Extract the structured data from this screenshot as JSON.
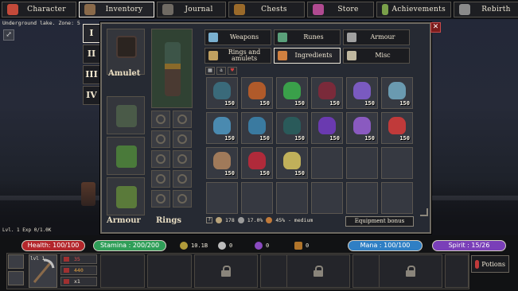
{
  "nav": [
    {
      "label": "Character",
      "icon": "skull-character-icon",
      "color": "#c44a3a"
    },
    {
      "label": "Inventory",
      "icon": "backpack-icon",
      "color": "#8a6a4a",
      "active": true
    },
    {
      "label": "Journal",
      "icon": "quill-icon",
      "color": "#6f6a63"
    },
    {
      "label": "Chests",
      "icon": "chest-icon",
      "color": "#9a6a2a"
    },
    {
      "label": "Store",
      "icon": "gem-store-icon",
      "color": "#b04a90"
    },
    {
      "label": "Achievements",
      "icon": "trophy-achievements-icon",
      "color": "#7aa04a"
    },
    {
      "label": "Rebirth",
      "icon": "rebirth-swirl-icon",
      "color": "#8a8a8a"
    }
  ],
  "zone_text": "Underground lake. Zone: 5",
  "level_exp": "Lvl. 1 Exp 0/1.0K",
  "tiers": [
    "I",
    "II",
    "III",
    "IV"
  ],
  "equipment": {
    "amulet_label": "Amulet",
    "armour_label": "Armour",
    "rings_label": "Rings"
  },
  "categories": [
    {
      "label": "Weapons",
      "icon": "sword-icon",
      "color": "#7ab0d0"
    },
    {
      "label": "Runes",
      "icon": "rune-icon",
      "color": "#5aa07a"
    },
    {
      "label": "Armour",
      "icon": "helmet-icon",
      "color": "#a0a0a0"
    },
    {
      "label": "Rings and amulets",
      "icon": "ring-icon",
      "color": "#c0a060"
    },
    {
      "label": "Ingredients",
      "icon": "herb-icon",
      "color": "#d08040",
      "active": true
    },
    {
      "label": "Misc",
      "icon": "scroll-icon",
      "color": "#c0b8a0"
    }
  ],
  "sort_buttons": [
    "▦",
    "a",
    "♥"
  ],
  "items": [
    {
      "qty": "150",
      "color": "#3a6a7a",
      "icon": "blue-leaf-plant-icon"
    },
    {
      "qty": "150",
      "color": "#b05a2a",
      "icon": "orange-berry-plant-icon"
    },
    {
      "qty": "150",
      "color": "#3aa04a",
      "icon": "green-herb-icon"
    },
    {
      "qty": "150",
      "color": "#7a2a3a",
      "icon": "red-twig-icon"
    },
    {
      "qty": "150",
      "color": "#7a5ac0",
      "icon": "purple-flower-icon"
    },
    {
      "qty": "150",
      "color": "#6a9ab0",
      "icon": "blue-flower-cluster-icon"
    },
    {
      "qty": "150",
      "color": "#4a8ab0",
      "icon": "blue-crystal-plant-icon"
    },
    {
      "qty": "150",
      "color": "#3a7aa0",
      "icon": "blue-lily-icon"
    },
    {
      "qty": "150",
      "color": "#2a5a5a",
      "icon": "teal-fern-icon"
    },
    {
      "qty": "150",
      "color": "#6a3ab0",
      "icon": "purple-berries-icon"
    },
    {
      "qty": "150",
      "color": "#8a5ac0",
      "icon": "purple-mushroom-icon"
    },
    {
      "qty": "150",
      "color": "#c03a3a",
      "icon": "red-mushroom-icon"
    },
    {
      "qty": "150",
      "color": "#a07a5a",
      "icon": "brown-mushroom-icon"
    },
    {
      "qty": "150",
      "color": "#b02a3a",
      "icon": "red-cap-mushroom-icon"
    },
    {
      "qty": "150",
      "color": "#c0b05a",
      "icon": "yellow-mushroom-cluster-icon"
    },
    {
      "qty": "",
      "color": "",
      "icon": ""
    },
    {
      "qty": "",
      "color": "",
      "icon": ""
    },
    {
      "qty": "",
      "color": "",
      "icon": ""
    },
    {
      "qty": "",
      "color": "",
      "icon": ""
    },
    {
      "qty": "",
      "color": "",
      "icon": ""
    },
    {
      "qty": "",
      "color": "",
      "icon": ""
    },
    {
      "qty": "",
      "color": "",
      "icon": ""
    },
    {
      "qty": "",
      "color": "",
      "icon": ""
    },
    {
      "qty": "",
      "color": "",
      "icon": ""
    }
  ],
  "panel_stats": {
    "help": "?",
    "resource_value": "178",
    "percent": "17.0%",
    "speed": "45% - medium"
  },
  "equipment_bonus_label": "Equipment bonus",
  "hud": {
    "health": "Health: 100/100",
    "stamina": "Stamina : 200/200",
    "gold": "10.1B",
    "res2": "0",
    "res3": "0",
    "res4": "0",
    "mana": "Mana : 100/100",
    "spirit": "Spirit : 15/26",
    "weapon_level": "lvl 1",
    "weapon_stats": [
      "35",
      "440",
      "x1"
    ],
    "potions_label": "Potions"
  },
  "colors": {
    "health": "#b3262b",
    "stamina": "#2f9e58",
    "mana": "#2f7fc4",
    "spirit": "#7a3fb8",
    "accent_border": "#ece6d8"
  }
}
